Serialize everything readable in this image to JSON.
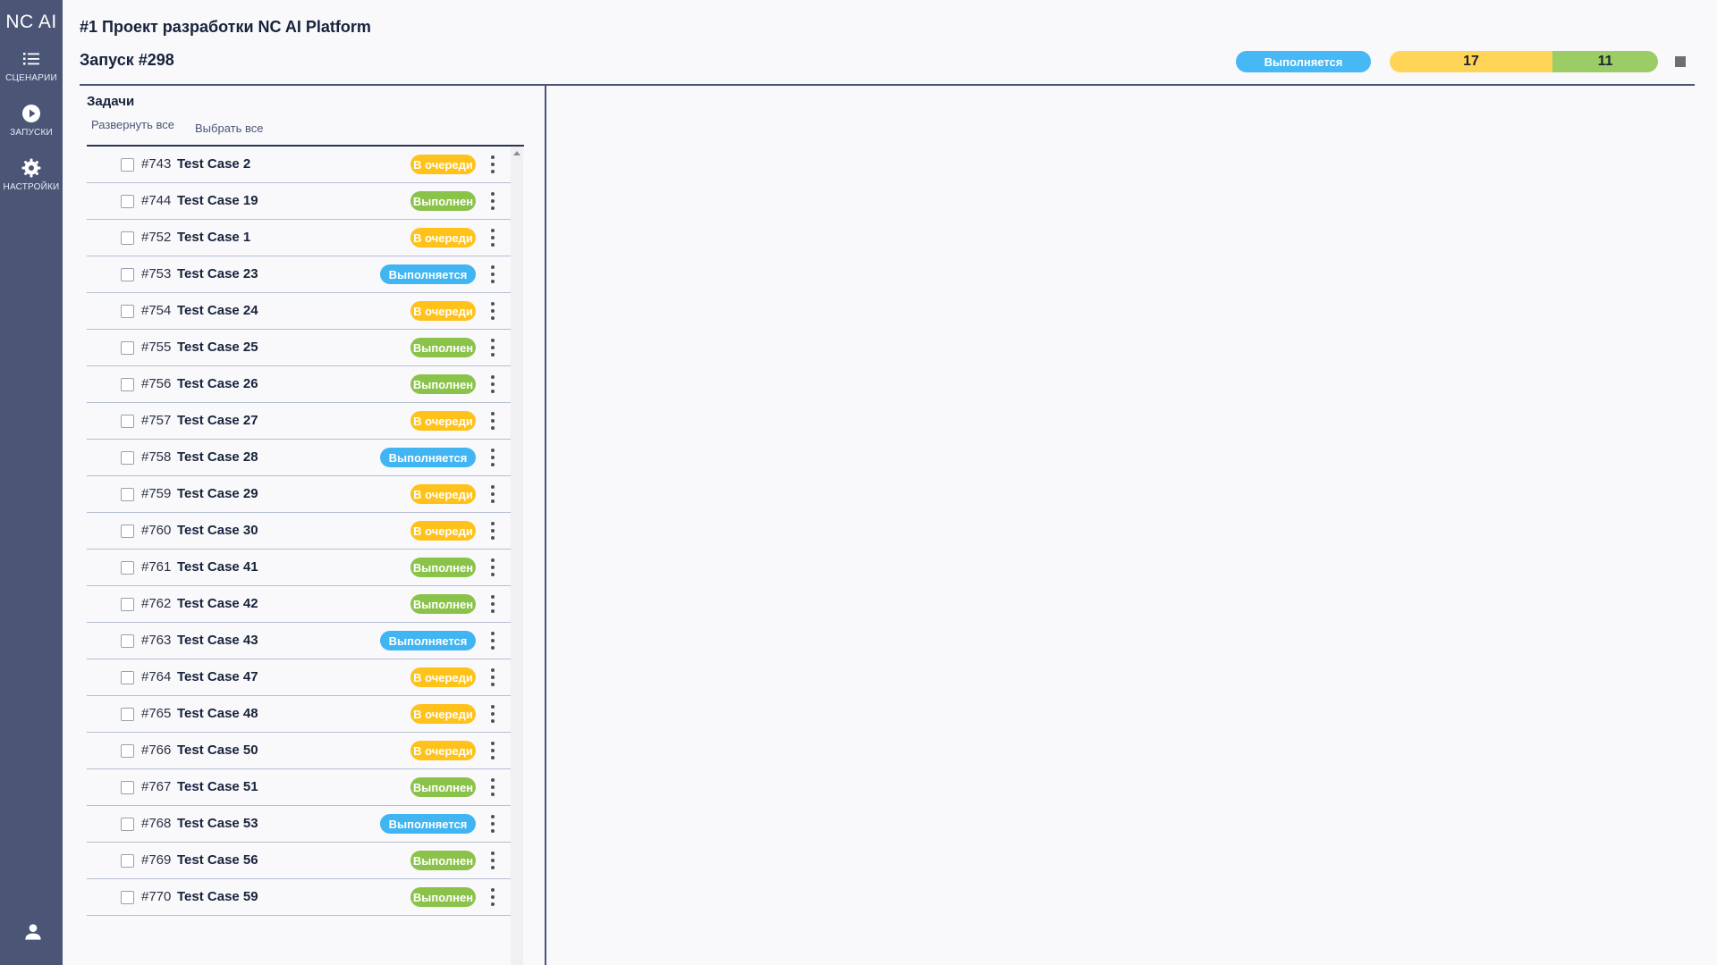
{
  "app": {
    "logo": "NC AI"
  },
  "sidebar": {
    "items": [
      {
        "label": "СЦЕНАРИИ",
        "icon": "list-icon"
      },
      {
        "label": "ЗАПУСКИ",
        "icon": "play-icon"
      },
      {
        "label": "НАСТРОЙКИ",
        "icon": "gear-icon"
      }
    ],
    "user_icon": "user-icon"
  },
  "header": {
    "project_title": "#1 Проект разработки NC AI Platform",
    "run_title": "Запуск #298",
    "run_status": "Выполняется",
    "progress": {
      "queued": "17",
      "done": "11",
      "queued_fraction": 0.607
    }
  },
  "tasks": {
    "title": "Задачи",
    "expand_all": "Развернуть все",
    "select_all": "Выбрать все",
    "items": [
      {
        "id": "#743",
        "name": "Test Case 2",
        "status": "В очереди",
        "kind": "queue"
      },
      {
        "id": "#744",
        "name": "Test Case 19",
        "status": "Выполнен",
        "kind": "done"
      },
      {
        "id": "#752",
        "name": "Test Case 1",
        "status": "В очереди",
        "kind": "queue"
      },
      {
        "id": "#753",
        "name": "Test Case 23",
        "status": "Выполняется",
        "kind": "running"
      },
      {
        "id": "#754",
        "name": "Test Case 24",
        "status": "В очереди",
        "kind": "queue"
      },
      {
        "id": "#755",
        "name": "Test Case 25",
        "status": "Выполнен",
        "kind": "done"
      },
      {
        "id": "#756",
        "name": "Test Case 26",
        "status": "Выполнен",
        "kind": "done"
      },
      {
        "id": "#757",
        "name": "Test Case 27",
        "status": "В очереди",
        "kind": "queue"
      },
      {
        "id": "#758",
        "name": "Test Case 28",
        "status": "Выполняется",
        "kind": "running"
      },
      {
        "id": "#759",
        "name": "Test Case 29",
        "status": "В очереди",
        "kind": "queue"
      },
      {
        "id": "#760",
        "name": "Test Case 30",
        "status": "В очереди",
        "kind": "queue"
      },
      {
        "id": "#761",
        "name": "Test Case 41",
        "status": "Выполнен",
        "kind": "done"
      },
      {
        "id": "#762",
        "name": "Test Case 42",
        "status": "Выполнен",
        "kind": "done"
      },
      {
        "id": "#763",
        "name": "Test Case 43",
        "status": "Выполняется",
        "kind": "running"
      },
      {
        "id": "#764",
        "name": "Test Case 47",
        "status": "В очереди",
        "kind": "queue"
      },
      {
        "id": "#765",
        "name": "Test Case 48",
        "status": "В очереди",
        "kind": "queue"
      },
      {
        "id": "#766",
        "name": "Test Case 50",
        "status": "В очереди",
        "kind": "queue"
      },
      {
        "id": "#767",
        "name": "Test Case 51",
        "status": "Выполнен",
        "kind": "done"
      },
      {
        "id": "#768",
        "name": "Test Case 53",
        "status": "Выполняется",
        "kind": "running"
      },
      {
        "id": "#769",
        "name": "Test Case 56",
        "status": "Выполнен",
        "kind": "done"
      },
      {
        "id": "#770",
        "name": "Test Case 59",
        "status": "Выполнен",
        "kind": "done"
      }
    ]
  },
  "colors": {
    "sidebar": "#4b5677",
    "queue": "#ffc21a",
    "done": "#8bc34a",
    "running": "#40b5f2"
  }
}
